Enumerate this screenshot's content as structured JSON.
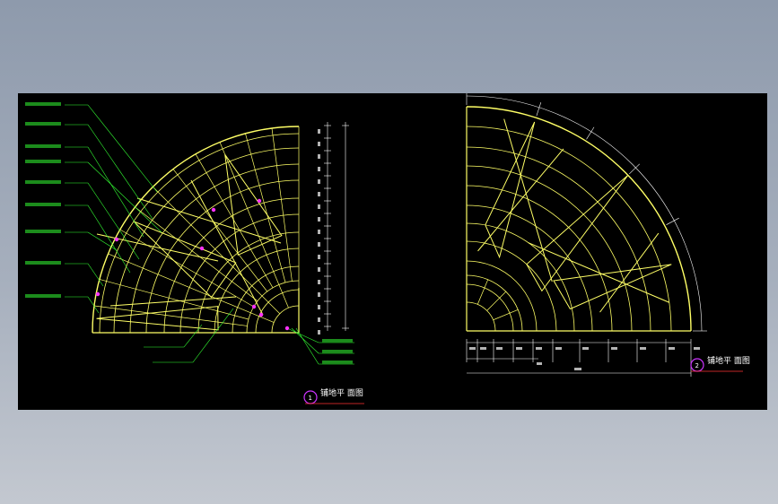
{
  "drawings": [
    {
      "id": "plan-1",
      "number": "1",
      "title": "铺地平 面图"
    },
    {
      "id": "plan-2",
      "number": "2",
      "title": "铺地平 面图"
    }
  ],
  "colors": {
    "background": "#000000",
    "paving": "#ffff66",
    "leader": "#33ff33",
    "dimension": "#ffffff",
    "marker": "#ff33ff",
    "title_circle": "#cc33ff",
    "title_underline": "#ff3333"
  }
}
